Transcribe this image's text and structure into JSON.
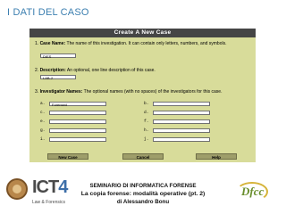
{
  "slide": {
    "title": "I DATI DEL CASO"
  },
  "form": {
    "header": "Create A New Case",
    "case_name": {
      "number": "1.",
      "label": "Case Name:",
      "text": "The name of this investigation. It can contain only letters, numbers, and symbols.",
      "value": "DIES"
    },
    "description": {
      "number": "2.",
      "label": "Description:",
      "text": "An optional, one line description of this case.",
      "value": "LAB-2"
    },
    "investigators": {
      "number": "3.",
      "label": "Investigator Names:",
      "text": "The optional names (with no spaces) of the investigators for this case.",
      "slots": [
        {
          "label": "a.",
          "value": "Forensed"
        },
        {
          "label": "b.",
          "value": ""
        },
        {
          "label": "c.",
          "value": ""
        },
        {
          "label": "d.",
          "value": ""
        },
        {
          "label": "e.",
          "value": ""
        },
        {
          "label": "f.",
          "value": ""
        },
        {
          "label": "g.",
          "value": ""
        },
        {
          "label": "h.",
          "value": ""
        },
        {
          "label": "i.",
          "value": ""
        },
        {
          "label": "j.",
          "value": ""
        }
      ]
    },
    "buttons": {
      "new_case": "New Case",
      "cancel": "Cancel",
      "help": "Help"
    }
  },
  "footer": {
    "seminar": "SEMINARIO DI INFORMATICA FORENSE",
    "subtitle": "La copia forense: modalità operative (pt. 2)",
    "author": "di Alessandro Bonu",
    "ict_logo_text": "ICT",
    "ict_logo_number": "4",
    "ict_logo_sub": "Law & Forensics",
    "dfcc_logo_text": "Dfcc"
  },
  "colors": {
    "title": "#3c7fb0",
    "form_bg": "#d8dc9a",
    "header_bg": "#454545",
    "button_bg": "#9e9e6a"
  }
}
